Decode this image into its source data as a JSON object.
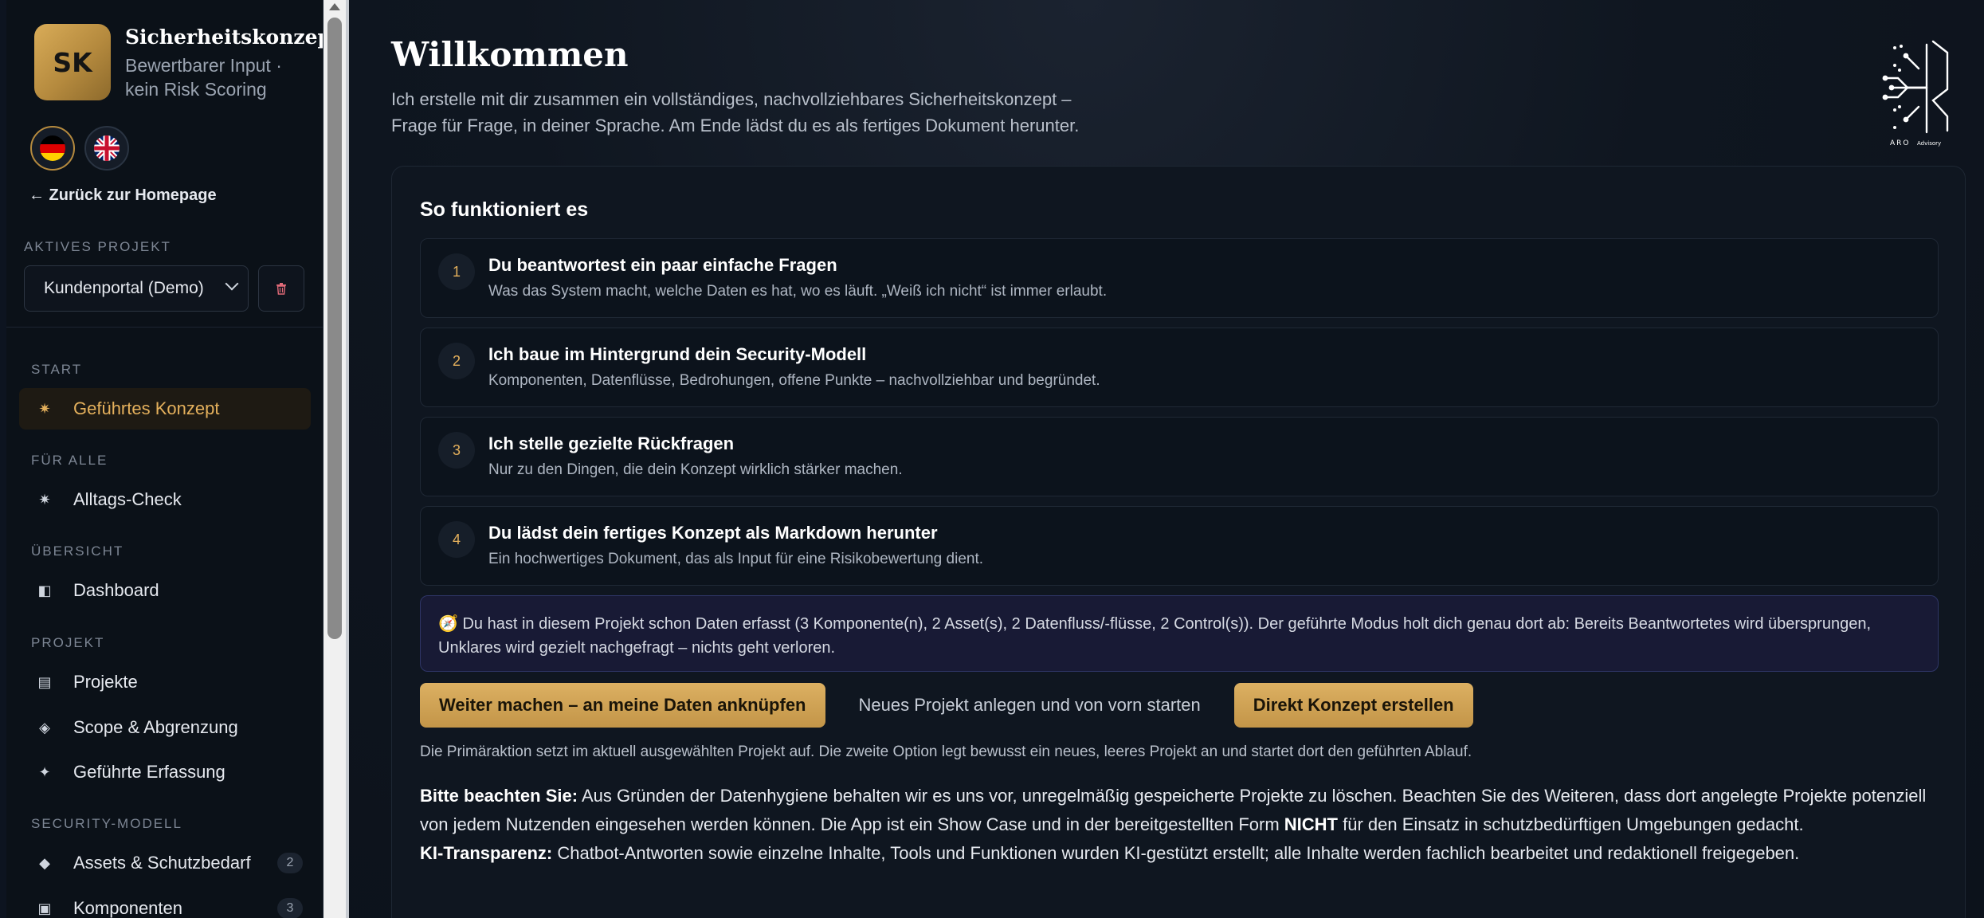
{
  "sidebar": {
    "brand": {
      "logo_text": "SK",
      "title": "Sicherheitskonzept",
      "subtitle": "Bewertbarer Input · kein Risk Scoring"
    },
    "flags": [
      {
        "label": "Deutsch",
        "icon": "flag-de-icon"
      },
      {
        "label": "English",
        "icon": "flag-uk-icon"
      }
    ],
    "back_link": "← Zurück zur Homepage",
    "active_project_label": "AKTIVES PROJEKT",
    "active_project_value": "Kundenportal (Demo)",
    "sections": {
      "start": "START",
      "fuer_alle": "FÜR ALLE",
      "uebersicht": "ÜBERSICHT",
      "projekt": "PROJEKT",
      "security_modell": "SECURITY-MODELL"
    },
    "items": {
      "gefuehrtes_konzept": "Geführtes Konzept",
      "alltags_check": "Alltags-Check",
      "dashboard": "Dashboard",
      "projekte": "Projekte",
      "scope": "Scope & Abgrenzung",
      "gefuehrte_erfassung": "Geführte Erfassung",
      "assets": "Assets & Schutzbedarf",
      "assets_count": "2",
      "komponenten": "Komponenten",
      "komponenten_count": "3"
    }
  },
  "main": {
    "title": "Willkommen",
    "intro": "Ich erstelle mit dir zusammen ein vollständiges, nachvollziehbares Sicherheitskonzept – Frage für Frage, in deiner Sprache. Am Ende lädst du es als fertiges Dokument herunter.",
    "logo": {
      "name": "ARO",
      "tagline": "Advisory"
    },
    "how_title": "So funktioniert es",
    "steps": [
      {
        "num": "1",
        "title": "Du beantwortest ein paar einfache Fragen",
        "desc": "Was das System macht, welche Daten es hat, wo es läuft. „Weiß ich nicht“ ist immer erlaubt."
      },
      {
        "num": "2",
        "title": "Ich baue im Hintergrund dein Security-Modell",
        "desc": "Komponenten, Datenflüsse, Bedrohungen, offene Punkte – nachvollziehbar und begründet."
      },
      {
        "num": "3",
        "title": "Ich stelle gezielte Rückfragen",
        "desc": "Nur zu den Dingen, die dein Konzept wirklich stärker machen."
      },
      {
        "num": "4",
        "title": "Du lädst dein fertiges Konzept als Markdown herunter",
        "desc": "Ein hochwertiges Dokument, das als Input für eine Risikobewertung dient."
      }
    ],
    "notice": "🧭 Du hast in diesem Projekt schon Daten erfasst (3 Komponente(n), 2 Asset(s), 2 Datenfluss/-flüsse, 2 Control(s)). Der geführte Modus holt dich genau dort ab: Bereits Beantwortetes wird übersprungen, Unklares wird gezielt nachgefragt – nichts geht verloren.",
    "buttons": {
      "continue": "Weiter machen – an meine Daten anknüpfen",
      "new_project": "Neues Projekt anlegen und von vorn starten",
      "direct": "Direkt Konzept erstellen"
    },
    "hint": "Die Primäraktion setzt im aktuell ausgewählten Projekt auf. Die zweite Option legt bewusst ein neues, leeres Projekt an und startet dort den geführten Ablauf.",
    "note1_label": "Bitte beachten Sie:",
    "note1_text_a": " Aus Gründen der Datenhygiene behalten wir es uns vor, unregelmäßig gespeicherte Projekte zu löschen. Beachten Sie des Weiteren, dass dort angelegte Projekte potenziell von jedem Nutzenden eingesehen werden können. Die App ist ein Show Case und in der bereitgestellten Form ",
    "note1_strong": "NICHT",
    "note1_text_b": " für den Einsatz in schutzbedürftigen Umgebungen gedacht.",
    "note2_label": "KI-Transparenz:",
    "note2_text": " Chatbot-Antworten sowie einzelne Inhalte, Tools und Funktionen wurden KI-gestützt erstellt; alle Inhalte werden fachlich bearbeitet und redaktionell freigegeben."
  },
  "colors": {
    "accent": "#e4b05c",
    "background": "#0d1420",
    "notice_bg": "#181a35"
  }
}
